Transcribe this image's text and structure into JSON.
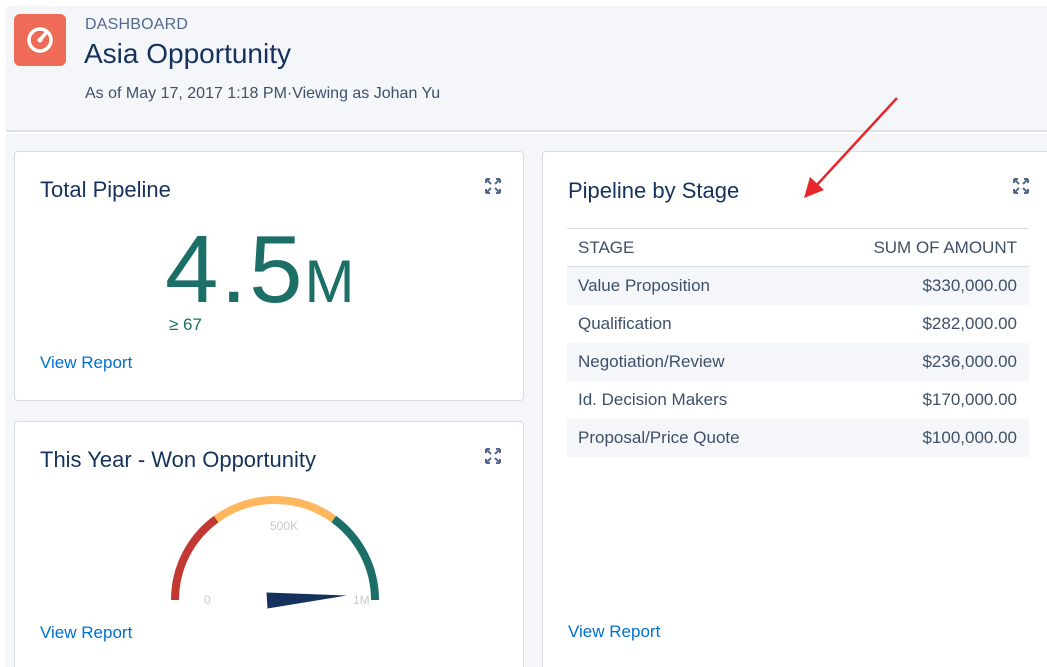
{
  "header": {
    "label": "DASHBOARD",
    "title": "Asia Opportunity",
    "subtitle": "As of May 17, 2017 1:18 PM·Viewing as Johan Yu",
    "icon": "dashboard-gauge-icon",
    "icon_color": "#ee6b57"
  },
  "total_pipeline": {
    "title": "Total Pipeline",
    "value": "4.5",
    "unit": "M",
    "sub_value": "≥ 67",
    "link": "View Report",
    "metric_color": "#1b6f66"
  },
  "won_opportunity": {
    "title": "This Year - Won Opportunity",
    "link": "View Report",
    "gauge": {
      "min_label": "0",
      "mid_label": "500K",
      "max_label": "1M",
      "needle_fraction": 0.98,
      "segment_colors": [
        "#c23934",
        "#ffb75d",
        "#1b6f66"
      ]
    }
  },
  "pipeline_by_stage": {
    "title": "Pipeline by Stage",
    "link": "View Report",
    "columns": [
      "STAGE",
      "SUM OF AMOUNT"
    ],
    "rows": [
      {
        "stage": "Value Proposition",
        "amount": "$330,000.00"
      },
      {
        "stage": "Qualification",
        "amount": "$282,000.00"
      },
      {
        "stage": "Negotiation/Review",
        "amount": "$236,000.00"
      },
      {
        "stage": "Id. Decision Makers",
        "amount": "$170,000.00"
      },
      {
        "stage": "Proposal/Price Quote",
        "amount": "$100,000.00"
      }
    ]
  },
  "annotation": {
    "arrow_color": "#e5262a"
  },
  "colors": {
    "link": "#0070d2",
    "canvas": "#f4f6f9"
  }
}
